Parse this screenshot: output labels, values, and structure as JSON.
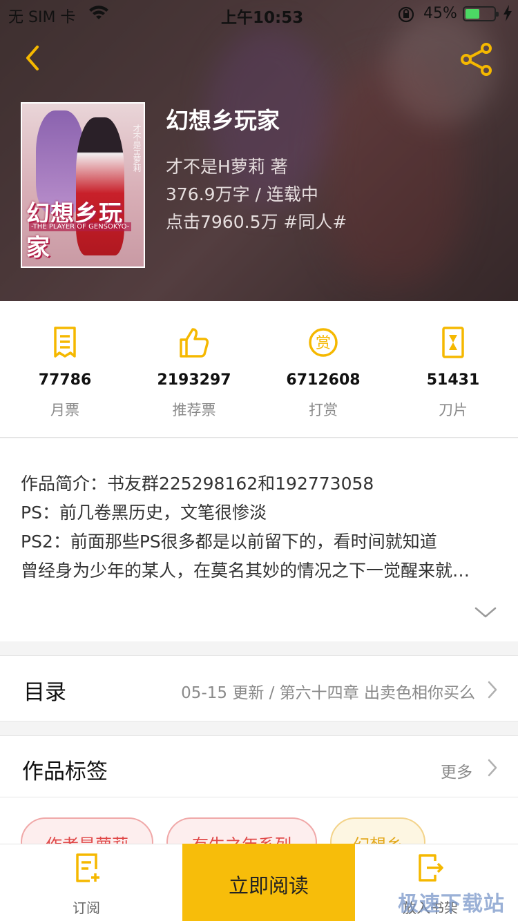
{
  "status_bar": {
    "carrier": "无 SIM 卡",
    "time": "上午10:53",
    "battery_percent": "45%"
  },
  "book": {
    "title": "幻想乡玩家",
    "author": "才不是H萝莉  著",
    "words_status": "376.9万字 / 连载中",
    "clicks_genre": "点击7960.5万  #同人#",
    "cover": {
      "title": "幻想乡玩家",
      "subtitle": "-THE PLAYER OF GENSOKYO-",
      "side_text": "才不是H萝莉"
    }
  },
  "stats": [
    {
      "icon": "monthly-ticket-icon",
      "value": "77786",
      "label": "月票"
    },
    {
      "icon": "thumbs-up-icon",
      "value": "2193297",
      "label": "推荐票"
    },
    {
      "icon": "reward-coin-icon",
      "value": "6712608",
      "label": "打赏"
    },
    {
      "icon": "blade-icon",
      "value": "51431",
      "label": "刀片"
    }
  ],
  "intro": {
    "lines": [
      "作品简介：书友群225298162和192773058",
      "PS：前几卷黑历史，文笔很惨淡",
      "PS2：前面那些PS很多都是以前留下的，看时间就知道",
      "曾经身为少年的某人，在莫名其妙的情况之下一觉醒来就…"
    ]
  },
  "catalog": {
    "title": "目录",
    "update": "05-15 更新 / 第六十四章 出卖色相你买么"
  },
  "tags": {
    "title": "作品标签",
    "more": "更多",
    "items": [
      "作者是萝莉",
      "有生之年系列",
      "幻想乡"
    ]
  },
  "bottom_bar": {
    "subscribe": "订阅",
    "read_now": "立即阅读",
    "add_shelf": "放入书架"
  },
  "watermark": "极速下载站",
  "colors": {
    "accent": "#f7bd0a",
    "icon_yellow": "#f5b800",
    "tag_red": "#e04848"
  }
}
